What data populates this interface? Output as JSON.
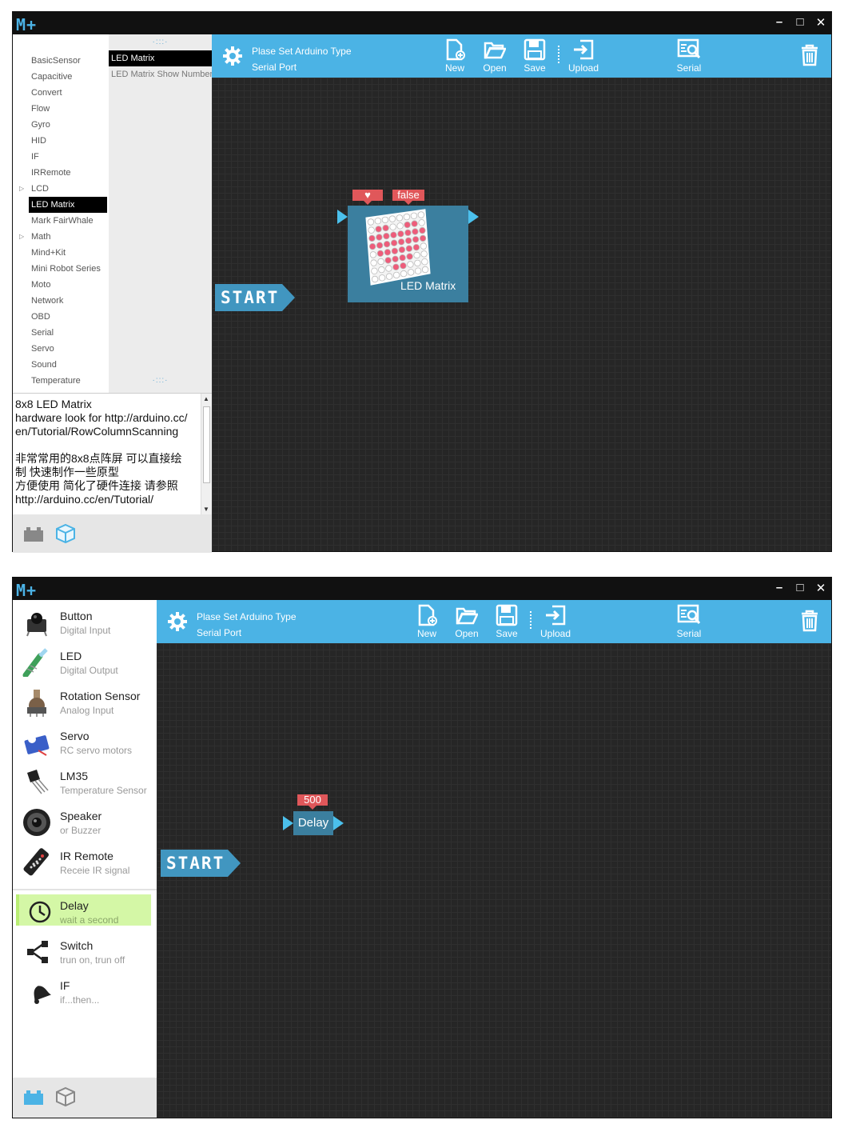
{
  "app": {
    "logo": "M+",
    "window_controls": [
      "–",
      "□",
      "✕"
    ]
  },
  "toolbar": {
    "arduino_type": "Plase Set Arduino Type",
    "serial_port": "Serial Port",
    "new_label": "New",
    "open_label": "Open",
    "save_label": "Save",
    "upload_label": "Upload",
    "serial_label": "Serial"
  },
  "window1": {
    "categories": [
      {
        "label": "BasicSensor",
        "expandable": false
      },
      {
        "label": "Capacitive",
        "expandable": false
      },
      {
        "label": "Convert",
        "expandable": false
      },
      {
        "label": "Flow",
        "expandable": false
      },
      {
        "label": "Gyro",
        "expandable": false
      },
      {
        "label": "HID",
        "expandable": false
      },
      {
        "label": "IF",
        "expandable": false
      },
      {
        "label": "IRRemote",
        "expandable": false
      },
      {
        "label": "LCD",
        "expandable": true
      },
      {
        "label": "LED Matrix",
        "expandable": false,
        "selected": true
      },
      {
        "label": "Mark FairWhale",
        "expandable": false
      },
      {
        "label": "Math",
        "expandable": true
      },
      {
        "label": "Mind+Kit",
        "expandable": false
      },
      {
        "label": "Mini Robot Series",
        "expandable": false
      },
      {
        "label": "Moto",
        "expandable": false
      },
      {
        "label": "Network",
        "expandable": false
      },
      {
        "label": "OBD",
        "expandable": false
      },
      {
        "label": "Serial",
        "expandable": false
      },
      {
        "label": "Servo",
        "expandable": false
      },
      {
        "label": "Sound",
        "expandable": false
      },
      {
        "label": "Temperature",
        "expandable": false
      }
    ],
    "subitems": [
      {
        "label": "LED Matrix",
        "selected": true
      },
      {
        "label": "LED Matrix Show Number",
        "selected": false
      }
    ],
    "description": "8x8 LED Matrix\nhardware look for http://arduino.cc/\nen/Tutorial/RowColumnScanning\n\n非常常用的8x8点阵屏 可以直接绘\n制 快速制作一些原型\n方便使用 简化了硬件连接 请参照\nhttp://arduino.cc/en/Tutorial/",
    "canvas": {
      "start_label": "START",
      "block_label": "LED Matrix",
      "param_heart": "♥",
      "param_bool": "false"
    }
  },
  "window2": {
    "components": [
      {
        "name": "Button",
        "desc": "Digital Input",
        "icon": "button-icon"
      },
      {
        "name": "LED",
        "desc": "Digital Output",
        "icon": "led-icon"
      },
      {
        "name": "Rotation Sensor",
        "desc": "Analog Input",
        "icon": "potentiometer-icon"
      },
      {
        "name": "Servo",
        "desc": "RC servo motors",
        "icon": "servo-icon"
      },
      {
        "name": "LM35",
        "desc": "Temperature Sensor",
        "icon": "lm35-icon"
      },
      {
        "name": "Speaker",
        "desc": "or Buzzer",
        "icon": "speaker-icon"
      },
      {
        "name": "IR Remote",
        "desc": "Receie IR signal",
        "icon": "remote-icon"
      }
    ],
    "flow": [
      {
        "name": "Delay",
        "desc": "wait a second",
        "icon": "clock-icon",
        "active": true
      },
      {
        "name": "Switch",
        "desc": "trun on, trun off",
        "icon": "share-icon"
      },
      {
        "name": "IF",
        "desc": "if...then...",
        "icon": "bell-icon"
      }
    ],
    "canvas": {
      "start_label": "START",
      "delay_label": "Delay",
      "delay_param": "500"
    }
  },
  "colors": {
    "accent": "#4bb3e5",
    "block": "#3b7f9f",
    "param": "#e0575a",
    "canvas": "#262626",
    "active_item": "#d4f7a6"
  }
}
